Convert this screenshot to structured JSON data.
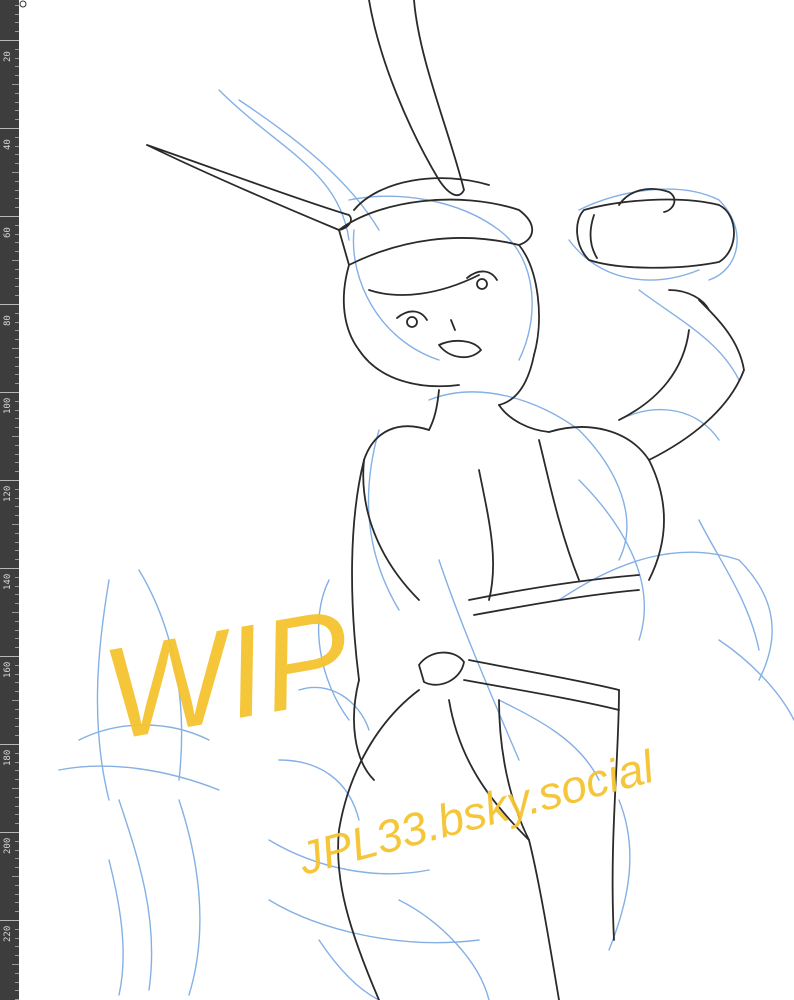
{
  "ruler": {
    "labels": [
      "20",
      "40",
      "60",
      "80",
      "100",
      "120",
      "140",
      "160",
      "180",
      "200",
      "220"
    ]
  },
  "canvas": {
    "watermark": {
      "title": "WIP",
      "handle": "JPL33.bsky.social",
      "color": "#f5c430"
    },
    "sketch_colors": {
      "line": "#2a2a2a",
      "construction": "#6fa3e0"
    }
  }
}
